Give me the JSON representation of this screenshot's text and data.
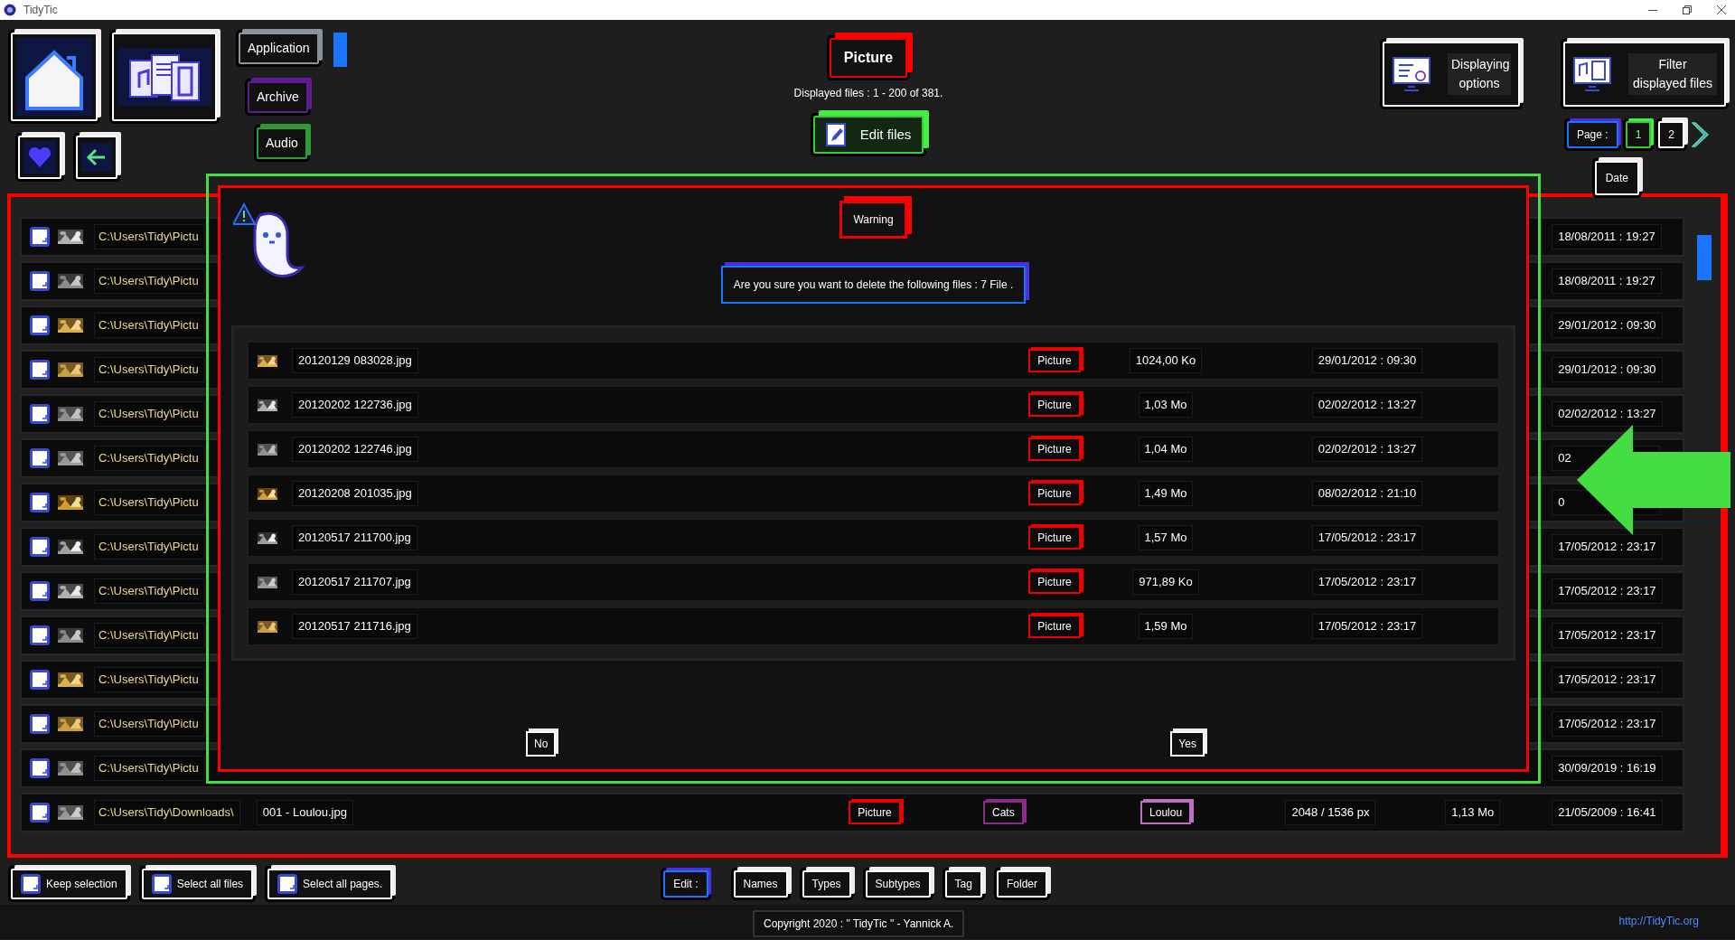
{
  "window": {
    "title": "TidyTic"
  },
  "categories": [
    {
      "label": "Application",
      "color": "#8a929c",
      "selected": true
    },
    {
      "label": "Archive",
      "color": "#5b1d8f",
      "selected": false
    },
    {
      "label": "Audio",
      "color": "#2e9a33",
      "selected": false
    }
  ],
  "current_type": "Picture",
  "displayed_info": "Displayed files : 1 - 200 of 381.",
  "edit_button": "Edit files",
  "option_buttons": [
    {
      "kind": "display",
      "label": "Displaying options"
    },
    {
      "kind": "filter",
      "label": "Filter displayed files"
    }
  ],
  "pagination": {
    "label": "Page :",
    "pages": [
      {
        "label": "1",
        "selected": true
      },
      {
        "label": "2",
        "selected": false
      }
    ]
  },
  "column_header": "Date",
  "rows": [
    {
      "path": "C:\\Users\\Tidy\\Pictu",
      "date": "18/08/2011 : 19:27"
    },
    {
      "path": "C:\\Users\\Tidy\\Pictu",
      "date": "18/08/2011 : 19:27"
    },
    {
      "path": "C:\\Users\\Tidy\\Pictu",
      "date": "29/01/2012 : 09:30"
    },
    {
      "path": "C:\\Users\\Tidy\\Pictu",
      "date": "29/01/2012 : 09:30"
    },
    {
      "path": "C:\\Users\\Tidy\\Pictu",
      "date": "02/02/2012 : 13:27"
    },
    {
      "path": "C:\\Users\\Tidy\\Pictu",
      "date": "02"
    },
    {
      "path": "C:\\Users\\Tidy\\Pictu",
      "date": "0"
    },
    {
      "path": "C:\\Users\\Tidy\\Pictu",
      "date": "17/05/2012 : 23:17"
    },
    {
      "path": "C:\\Users\\Tidy\\Pictu",
      "date": "17/05/2012 : 23:17"
    },
    {
      "path": "C:\\Users\\Tidy\\Pictu",
      "date": "17/05/2012 : 23:17"
    },
    {
      "path": "C:\\Users\\Tidy\\Pictu",
      "date": "17/05/2012 : 23:17"
    },
    {
      "path": "C:\\Users\\Tidy\\Pictu",
      "date": "17/05/2012 : 23:17"
    },
    {
      "path": "C:\\Users\\Tidy\\Pictu",
      "date": "30/09/2019 : 16:19"
    },
    {
      "path": "C:\\Users\\Tidy\\Downloads\\",
      "name": "001 - Loulou.jpg",
      "type": "Picture",
      "subtype": "Cats",
      "tag": "Loulou",
      "dimensions": "2048 / 1536 px",
      "size": "1,13 Mo",
      "date": "21/05/2009 : 16:41"
    }
  ],
  "dialog": {
    "title": "Warning",
    "message": "Are you sure you want to delete the following files : 7 File .",
    "files": [
      {
        "name": "20120129 083028.jpg",
        "type": "Picture",
        "size": "1024,00 Ko",
        "date": "29/01/2012 : 09:30"
      },
      {
        "name": "20120202 122736.jpg",
        "type": "Picture",
        "size": "1,03 Mo",
        "date": "02/02/2012 : 13:27"
      },
      {
        "name": "20120202 122746.jpg",
        "type": "Picture",
        "size": "1,04 Mo",
        "date": "02/02/2012 : 13:27"
      },
      {
        "name": "20120208 201035.jpg",
        "type": "Picture",
        "size": "1,49 Mo",
        "date": "08/02/2012 : 21:10"
      },
      {
        "name": "20120517 211700.jpg",
        "type": "Picture",
        "size": "1,57 Mo",
        "date": "17/05/2012 : 23:17"
      },
      {
        "name": "20120517 211707.jpg",
        "type": "Picture",
        "size": "971,89 Ko",
        "date": "17/05/2012 : 23:17"
      },
      {
        "name": "20120517 211716.jpg",
        "type": "Picture",
        "size": "1,59 Mo",
        "date": "17/05/2012 : 23:17"
      }
    ],
    "buttons": [
      "No",
      "Yes"
    ]
  },
  "bottom_bar": {
    "selection_buttons": [
      "Keep selection",
      "Select all files",
      "Select all pages."
    ],
    "edit_label": "Edit :",
    "edit_buttons": [
      "Names",
      "Types",
      "Subtypes",
      "Tag",
      "Folder"
    ]
  },
  "footer": {
    "copyright": "Copyright 2020 : \" TidyTic \" - Yannick A.",
    "link": "http://TidyTic.org"
  }
}
